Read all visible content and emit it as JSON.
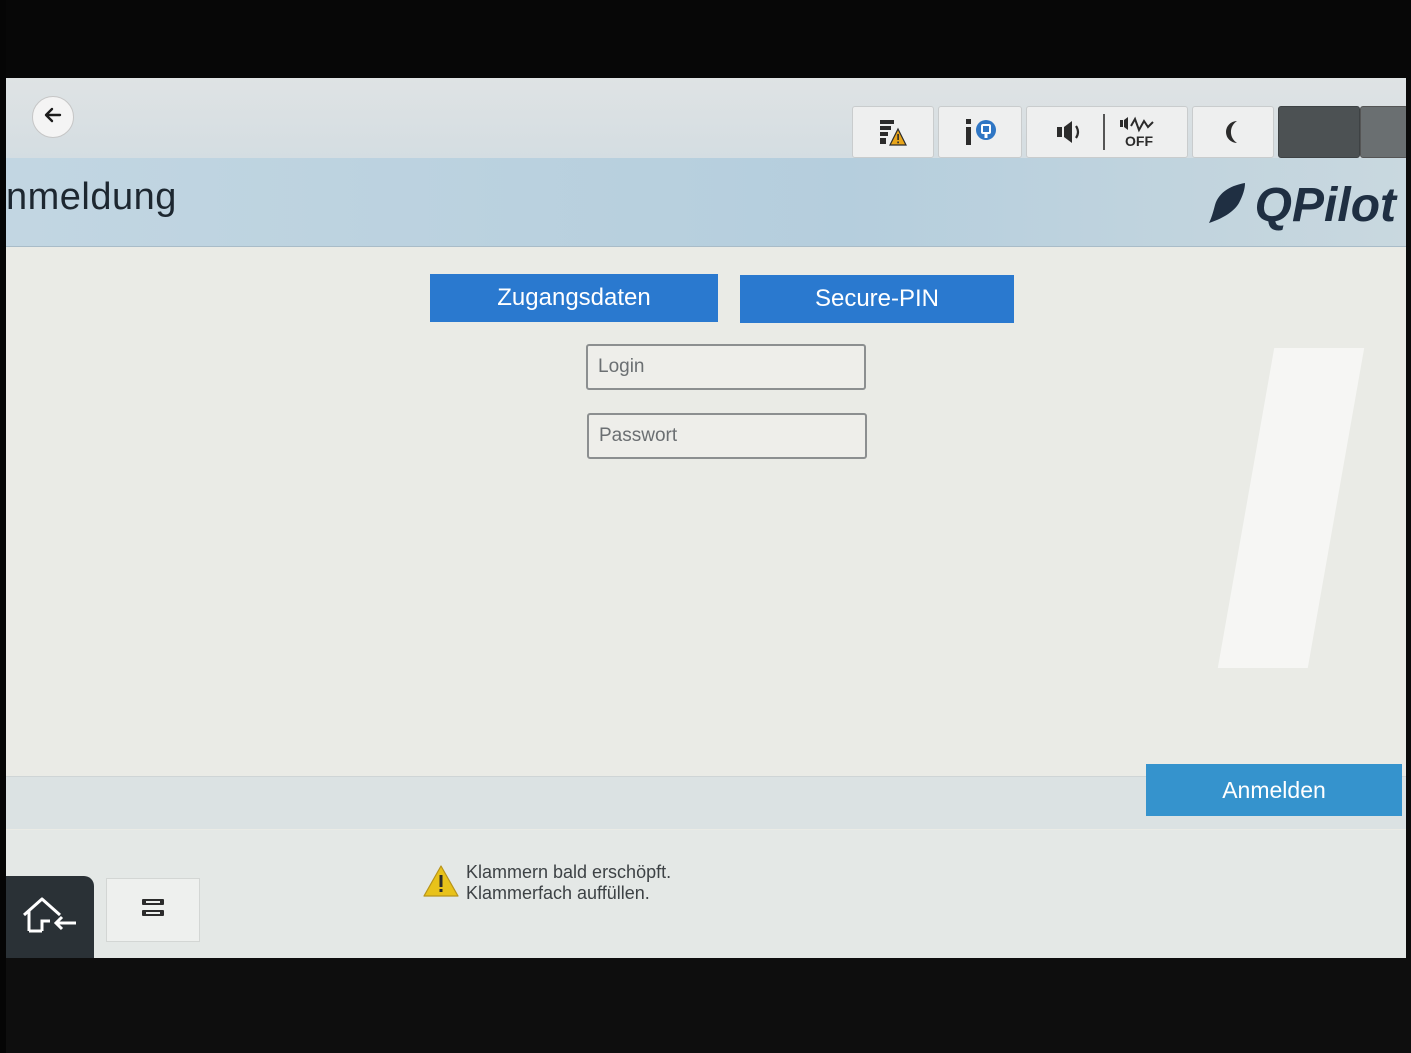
{
  "header": {
    "title": "nmeldung",
    "brand": "QPilot",
    "toolbar_icons": [
      "back-arrow-icon",
      "supplies-warning-icon",
      "device-info-icon",
      "volume-icon",
      "quiet-mode-off-icon",
      "sleep-moon-icon"
    ],
    "quiet_label": "OFF"
  },
  "tabs": [
    {
      "label": "Zugangsdaten"
    },
    {
      "label": "Secure-PIN"
    }
  ],
  "form": {
    "login_placeholder": "Login",
    "password_placeholder": "Passwort",
    "submit_label": "Anmelden"
  },
  "status": {
    "line1": "Klammern bald erschöpft.",
    "line2": "Klammerfach auffüllen."
  },
  "colors": {
    "tab_blue": "#2a79cf",
    "submit_blue": "#3593cd",
    "warning_yellow": "#e8c21a"
  }
}
